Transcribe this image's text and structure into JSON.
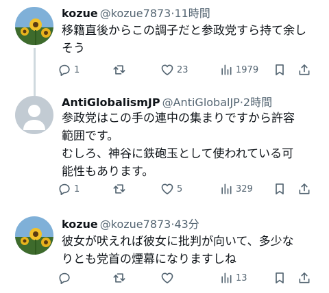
{
  "tweets": [
    {
      "name": "kozue",
      "handle": "@kozue7873",
      "time": "·11時間",
      "lines": [
        "移籍直後からこの調子だと参政党すら持て余し",
        "そう"
      ],
      "replies": "1",
      "retweets": "",
      "likes": "23",
      "views": "1979"
    },
    {
      "name": "AntiGlobalismJP",
      "handle": "@AntiGlobalJP",
      "time": "·2時間",
      "lines": [
        "参政党はこの手の連中の集まりですから許容",
        "範囲です。",
        "むしろ、神谷に鉄砲玉として使われている可",
        "能性もあります。"
      ],
      "replies": "1",
      "retweets": "",
      "likes": "5",
      "views": "329"
    },
    {
      "name": "kozue",
      "handle": "@kozue7873",
      "time": "·43分",
      "lines": [
        "彼女が吠えれば彼女に批判が向いて、多少な",
        "りとも党首の煙幕になりますしね"
      ],
      "replies": "",
      "retweets": "",
      "likes": "",
      "views": "13"
    }
  ],
  "icons": {
    "reply": "reply-icon",
    "retweet": "retweet-icon",
    "like": "heart-icon",
    "views": "views-icon",
    "bookmark": "bookmark-icon",
    "share": "share-icon"
  },
  "colors": {
    "text": "#0f1419",
    "secondary": "#536471",
    "thread_line": "#cfd9de",
    "default_avatar": "#c2cbd3"
  }
}
